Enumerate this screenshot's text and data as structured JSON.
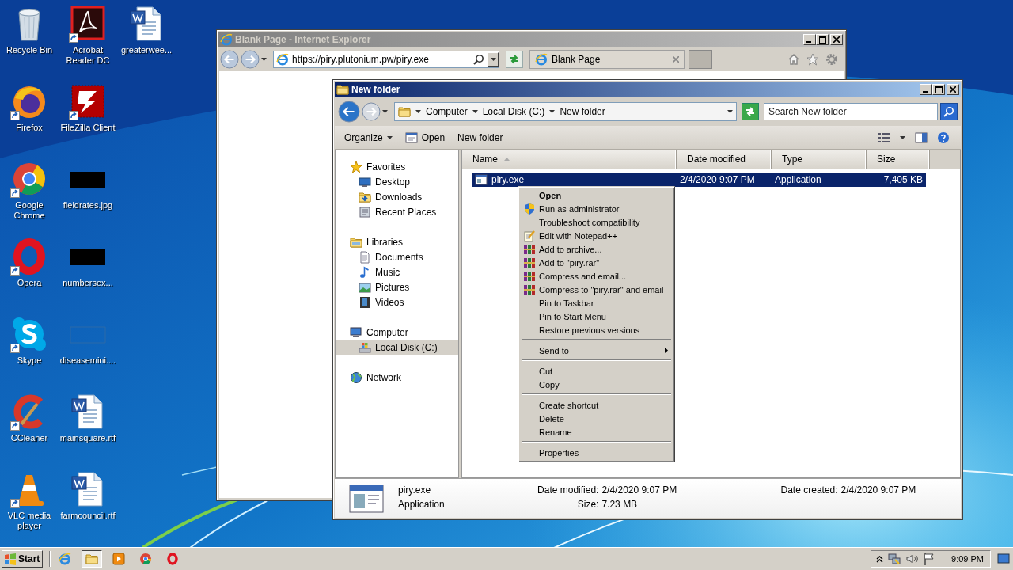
{
  "desktop_icons": [
    {
      "label": "Recycle Bin",
      "kind": "recycle",
      "shortcut": false
    },
    {
      "label": "Firefox",
      "kind": "firefox",
      "shortcut": true
    },
    {
      "label": "Google Chrome",
      "kind": "chrome",
      "shortcut": true
    },
    {
      "label": "Opera",
      "kind": "opera",
      "shortcut": true
    },
    {
      "label": "Skype",
      "kind": "skype",
      "shortcut": true
    },
    {
      "label": "CCleaner",
      "kind": "ccleaner",
      "shortcut": true
    },
    {
      "label": "VLC media player",
      "kind": "vlc",
      "shortcut": true
    },
    {
      "label": "Acrobat Reader DC",
      "kind": "acrobat",
      "shortcut": true
    },
    {
      "label": "FileZilla Client",
      "kind": "filezilla",
      "shortcut": true
    },
    {
      "label": "fieldrates.jpg",
      "kind": "thumbnail",
      "shortcut": false
    },
    {
      "label": "numbersex...",
      "kind": "thumbnail",
      "shortcut": false
    },
    {
      "label": "diseasemini....",
      "kind": "blank",
      "shortcut": false
    },
    {
      "label": "mainsquare.rtf",
      "kind": "word",
      "shortcut": false
    },
    {
      "label": "farmcouncil.rtf",
      "kind": "word",
      "shortcut": false
    },
    {
      "label": "greaterwee...",
      "kind": "word",
      "shortcut": false
    }
  ],
  "ie_window": {
    "title": "Blank Page - Internet Explorer",
    "active": false,
    "address": "https://piry.plutonium.pw/piry.exe",
    "tabs": [
      {
        "label": "Blank Page",
        "selected": true
      }
    ]
  },
  "explorer": {
    "title": "New folder",
    "active": true,
    "breadcrumb": [
      "Computer",
      "Local Disk (C:)",
      "New folder"
    ],
    "search": {
      "placeholder": "Search New folder"
    },
    "toolbar": [
      {
        "label": "Organize",
        "kind": "menu"
      },
      {
        "label": "Open",
        "kind": "open"
      },
      {
        "label": "New folder",
        "kind": "plain"
      }
    ],
    "nav": [
      {
        "label": "Favorites",
        "kind": "favorites",
        "selected": false,
        "children": [
          {
            "label": "Desktop",
            "kind": "desktop",
            "selected": false
          },
          {
            "label": "Downloads",
            "kind": "downloads",
            "selected": false
          },
          {
            "label": "Recent Places",
            "kind": "recent",
            "selected": false
          }
        ]
      },
      {
        "label": "Libraries",
        "kind": "libraries",
        "selected": false,
        "children": [
          {
            "label": "Documents",
            "kind": "documents",
            "selected": false
          },
          {
            "label": "Music",
            "kind": "music",
            "selected": false
          },
          {
            "label": "Pictures",
            "kind": "pictures",
            "selected": false
          },
          {
            "label": "Videos",
            "kind": "videos",
            "selected": false
          }
        ]
      },
      {
        "label": "Computer",
        "kind": "computer",
        "selected": false,
        "children": [
          {
            "label": "Local Disk (C:)",
            "kind": "disk",
            "selected": true
          }
        ]
      },
      {
        "label": "Network",
        "kind": "network",
        "selected": false
      }
    ],
    "columns": [
      "Name",
      "Date modified",
      "Type",
      "Size"
    ],
    "rows": [
      {
        "name": "piry.exe",
        "date": "2/4/2020 9:07 PM",
        "type": "Application",
        "size": "7,405 KB",
        "selected": true
      }
    ],
    "details": {
      "name": "piry.exe",
      "type": "Application",
      "modified_label": "Date modified:",
      "modified": "2/4/2020 9:07 PM",
      "size_label": "Size:",
      "size": "7.23 MB",
      "created_label": "Date created:",
      "created": "2/4/2020 9:07 PM"
    }
  },
  "context_menu": {
    "items": [
      {
        "label": "Open",
        "kind": "default"
      },
      {
        "label": "Run as administrator",
        "kind": "shield"
      },
      {
        "label": "Troubleshoot compatibility",
        "kind": "plain"
      },
      {
        "label": "Edit with Notepad++",
        "kind": "notepad"
      },
      {
        "label": "Add to archive...",
        "kind": "rar"
      },
      {
        "label": "Add to \"piry.rar\"",
        "kind": "rar"
      },
      {
        "label": "Compress and email...",
        "kind": "rar"
      },
      {
        "label": "Compress to \"piry.rar\" and email",
        "kind": "rar"
      },
      {
        "label": "Pin to Taskbar",
        "kind": "plain"
      },
      {
        "label": "Pin to Start Menu",
        "kind": "plain"
      },
      {
        "label": "Restore previous versions",
        "kind": "plain"
      },
      {
        "kind": "separator"
      },
      {
        "label": "Send to",
        "kind": "submenu"
      },
      {
        "kind": "separator"
      },
      {
        "label": "Cut",
        "kind": "plain"
      },
      {
        "label": "Copy",
        "kind": "plain"
      },
      {
        "kind": "separator"
      },
      {
        "label": "Create shortcut",
        "kind": "plain"
      },
      {
        "label": "Delete",
        "kind": "plain"
      },
      {
        "label": "Rename",
        "kind": "plain"
      },
      {
        "kind": "separator"
      },
      {
        "label": "Properties",
        "kind": "plain"
      }
    ]
  },
  "taskbar": {
    "start": "Start",
    "apps": [
      {
        "kind": "ie",
        "selected": false
      },
      {
        "kind": "explorer",
        "selected": true
      },
      {
        "kind": "media",
        "selected": false
      },
      {
        "kind": "chrome",
        "selected": false
      },
      {
        "kind": "opera",
        "selected": false
      }
    ],
    "clock": "9:09 PM"
  }
}
